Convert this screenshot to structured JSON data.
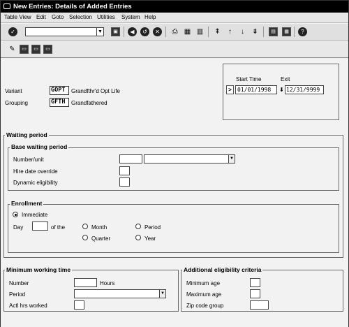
{
  "window": {
    "title": "New Entries: Details of Added Entries"
  },
  "menubar": [
    "Table View",
    "Edit",
    "Goto",
    "Selection",
    "Utilities",
    "System",
    "Help"
  ],
  "toolbar": {
    "command_value": ""
  },
  "header": {
    "variant_label": "Variant",
    "variant_code": "GOPT",
    "variant_desc": "Grandfthr'd Opt Life",
    "grouping_label": "Grouping",
    "grouping_code": "GFTH",
    "grouping_desc": "Grandfathered",
    "start_time_label": "Start Time",
    "exit_label": "Exit",
    "start_date": "01/01/1998",
    "end_date": "12/31/9999"
  },
  "waiting_period": {
    "title": "Waiting period",
    "base_title": "Base waiting period",
    "number_unit_label": "Number/unit",
    "hire_date_label": "Hire date override",
    "dynamic_label": "Dynamic eligibility",
    "number_value": "",
    "unit_value": ""
  },
  "enrollment": {
    "title": "Enrollment",
    "immediate_label": "Immediate",
    "day_label": "Day",
    "of_the_label": "of the",
    "month_label": "Month",
    "period_label": "Period",
    "quarter_label": "Quarter",
    "year_label": "Year",
    "selected": "Immediate"
  },
  "min_working": {
    "title": "Minimum working time",
    "number_label": "Number",
    "hours_label": "Hours",
    "period_label": "Period",
    "actl_label": "Actl hrs worked"
  },
  "additional": {
    "title": "Additional eligibility criteria",
    "min_age_label": "Minimum age",
    "max_age_label": "Maximum age",
    "zip_label": "Zip code group"
  }
}
